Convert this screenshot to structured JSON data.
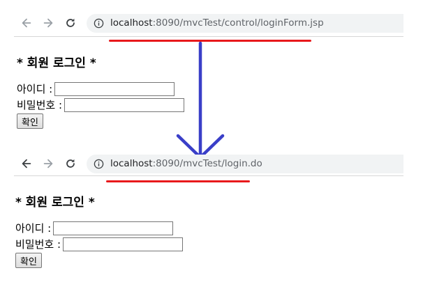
{
  "screens": [
    {
      "url_host": "localhost",
      "url_path": ":8090/mvcTest/control/loginForm.jsp",
      "heading": "* 회원 로그인 *",
      "id_label": "아이디 :",
      "id_value": "",
      "pw_label": "비밀번호 :",
      "pw_value": "",
      "submit_label": "확인"
    },
    {
      "url_host": "localhost",
      "url_path": ":8090/mvcTest/login.do",
      "heading": "* 회원 로그인 *",
      "id_label": "아이디 :",
      "id_value": "",
      "pw_label": "비밀번호 :",
      "pw_value": "",
      "submit_label": "확인"
    }
  ],
  "icons": {
    "back": "arrow-left-icon",
    "forward": "arrow-right-icon",
    "reload": "reload-icon",
    "info": "info-circle-icon",
    "transition": "arrow-down-icon"
  },
  "colors": {
    "highlight_underline": "#e8191c",
    "transition_arrow": "#3a3fc8",
    "omnibox_bg": "#f1f3f4"
  }
}
